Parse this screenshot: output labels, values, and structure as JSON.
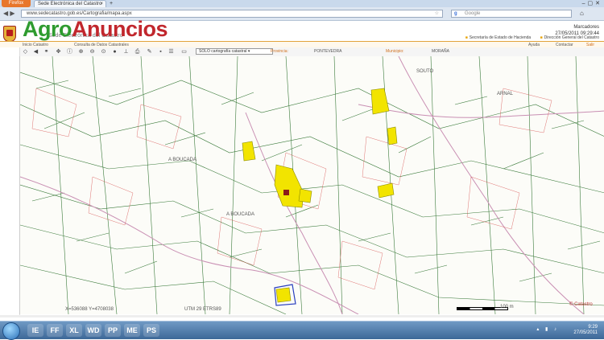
{
  "browser": {
    "menu_button": "Firefox",
    "tab_title": "Sede Electrónica del Catastro",
    "url": "www.sedecatastro.gob.es/Cartografia/mapa.aspx",
    "search_placeholder": "Google"
  },
  "header": {
    "watermark_agro": "Agro",
    "watermark_anuncios": "Anuncios",
    "site_subtitle": "Sede Electrónica del Catastro",
    "date": "27/05/2011 09:29:44",
    "user_link": "Marcadores",
    "links": [
      "Secretaría de Estado de Hacienda",
      "Dirección General del Catastro"
    ],
    "sub_links": [
      "Ayuda",
      "Contactar"
    ]
  },
  "menu": {
    "items": [
      "Inicio Catastro",
      "Consulta de Datos Catastrales"
    ],
    "exit": "Salir"
  },
  "toolbar": {
    "layer_value": "SOLO cartografía catastral",
    "province_label": "Provincia:",
    "province_value": "PONTEVEDRA",
    "municipality_label": "Municipio:",
    "municipality_value": "MORAÑA"
  },
  "map": {
    "place_labels": [
      "A BOUCADA",
      "A BOUCADA",
      "SOUTO",
      "ARNAL"
    ],
    "coords": "X=536088 Y=4708038",
    "utm": "UTM 29 ETRS89",
    "scale_label": "100 m",
    "copyright": "© Catastro"
  },
  "taskbar": {
    "apps": [
      "IE",
      "FF",
      "XL",
      "WD",
      "PP",
      "ME",
      "PS"
    ],
    "time": "9:29",
    "date": "27/05/2011"
  }
}
